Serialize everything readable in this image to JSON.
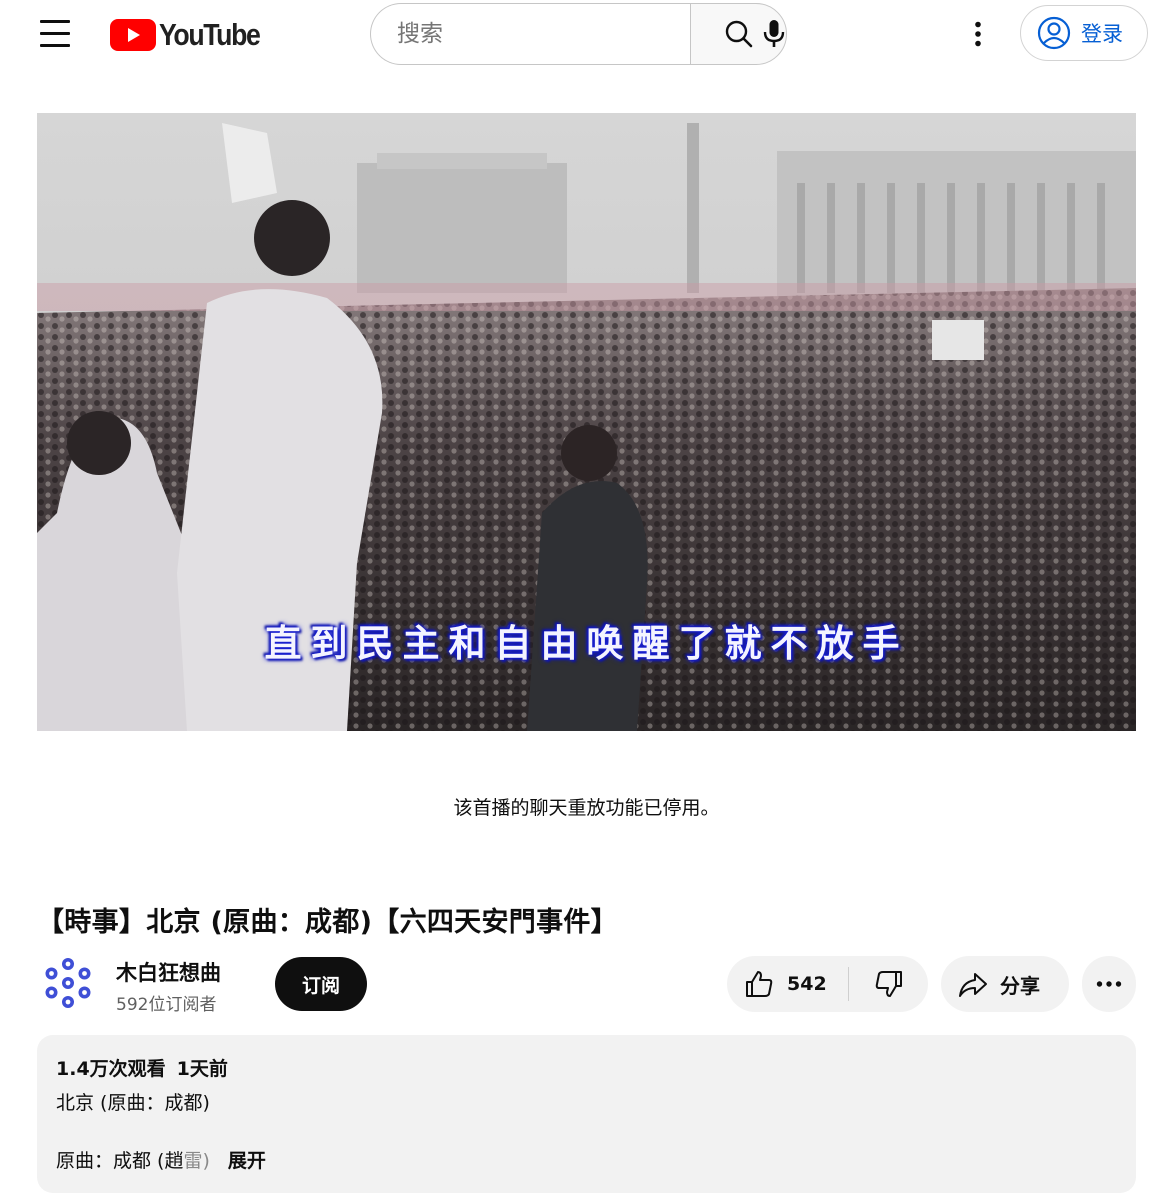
{
  "header": {
    "logo_text": "YouTube",
    "search_placeholder": "搜索",
    "signin_label": "登录"
  },
  "player": {
    "subtitle": "直到民主和自由唤醒了就不放手"
  },
  "chat_replay_note": "该首播的聊天重放功能已停用。",
  "video": {
    "title": "【時事】北京 (原曲：成都)【六四天安門事件】",
    "channel_name": "木白狂想曲",
    "subscribers": "592位订阅者",
    "subscribe_label": "订阅",
    "like_count": "542",
    "share_label": "分享"
  },
  "description": {
    "views": "1.4万次观看",
    "published": "1天前",
    "line1": "北京 (原曲：成都)",
    "line2_main": "原曲：成都 (趙",
    "line2_faded": "雷)",
    "expand_label": "展开"
  },
  "colors": {
    "brand_red": "#ff0000",
    "link_blue": "#065fd4",
    "subtitle_glow": "#1c23d8"
  },
  "icons": {
    "menu": "menu-icon",
    "search": "search-icon",
    "mic": "mic-icon",
    "more": "more-vert-icon",
    "account": "account-circle-icon",
    "like": "thumb-up-icon",
    "dislike": "thumb-down-icon",
    "share": "share-arrow-icon",
    "more_actions": "more-horiz-icon"
  }
}
